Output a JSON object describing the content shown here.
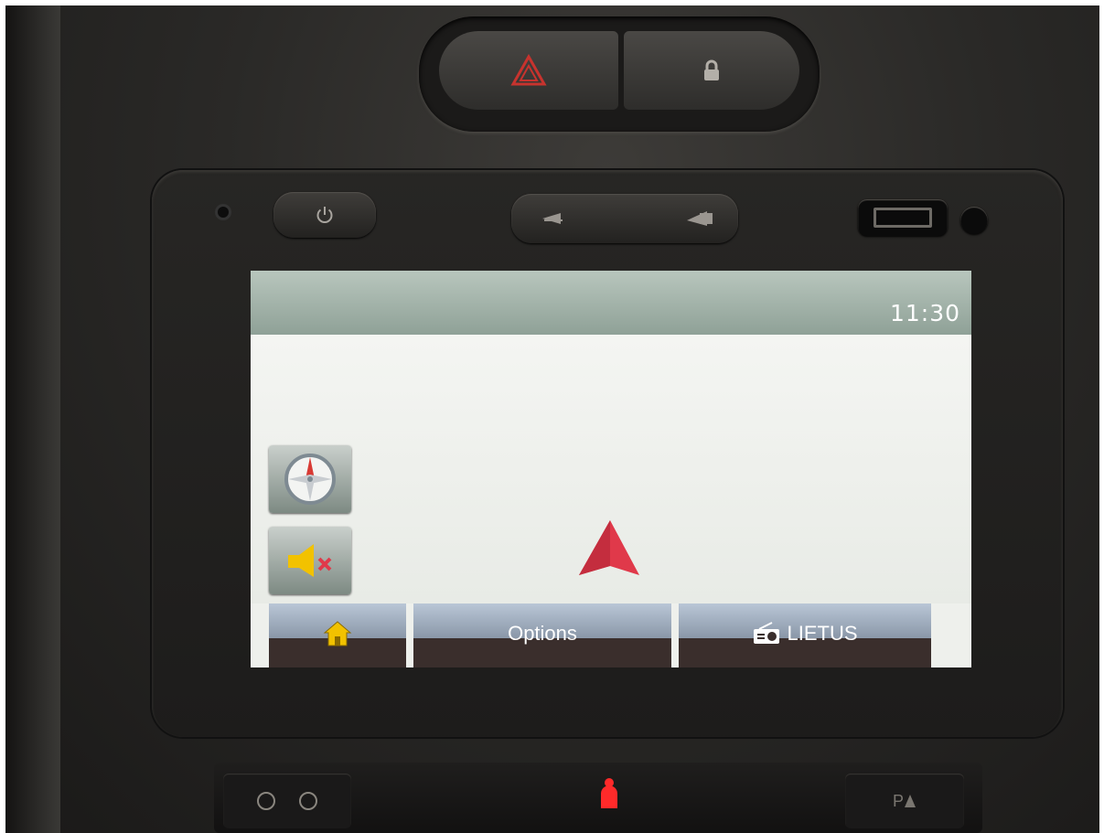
{
  "status_bar": {
    "clock": "11:30"
  },
  "bottom_bar": {
    "home_label": "",
    "options_label": "Options",
    "radio_label": "LIETUS"
  },
  "console": {
    "park_label": "P"
  },
  "colors": {
    "status_bar": "#a3b2a9",
    "map_background": "#eef0ec",
    "tab_bar": "#3a2e2c",
    "vehicle_arrow": "#e0394a",
    "home_icon": "#f2c200",
    "mute_speaker": "#f2c200",
    "mute_cross": "#e0394a"
  },
  "icons": {
    "hazard": "hazard-triangle-icon",
    "lock": "lock-icon",
    "power": "power-icon",
    "volume": "volume-rocker-icon",
    "compass": "compass-icon",
    "mute": "speaker-muted-icon",
    "home": "home-icon",
    "radio": "radio-icon",
    "vehicle": "vehicle-position-arrow-icon",
    "seatbelt": "seatbelt-warning-icon"
  }
}
